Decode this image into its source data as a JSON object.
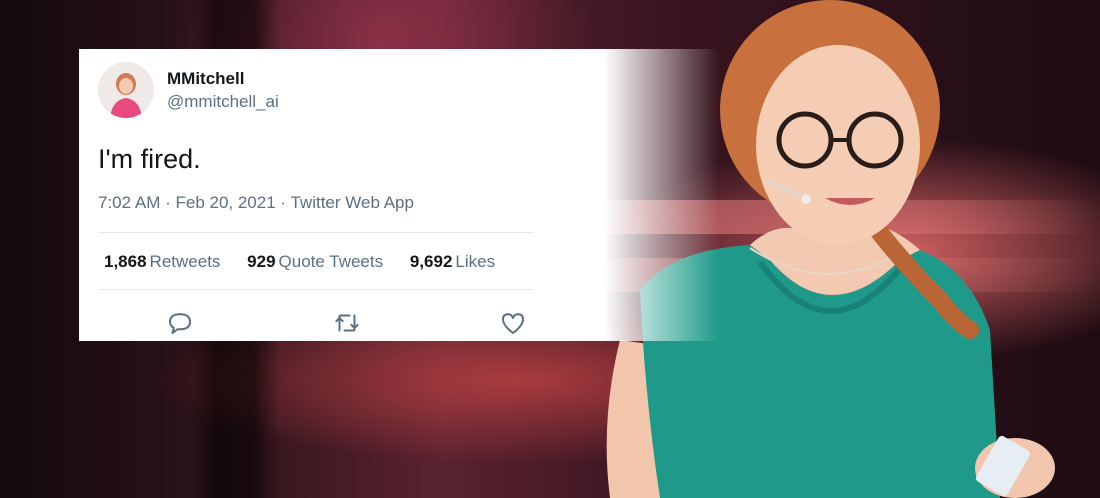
{
  "tweet": {
    "display_name": "MMitchell",
    "handle": "@mmitchell_ai",
    "text": "I'm fired.",
    "meta": "7:02 AM · Feb 20, 2021 · Twitter Web App",
    "stats": {
      "retweets_count": "1,868",
      "retweets_label": "Retweets",
      "quotes_count": "929",
      "quotes_label": "Quote Tweets",
      "likes_count": "9,692",
      "likes_label": "Likes"
    },
    "icons": [
      "reply-icon",
      "retweet-icon",
      "like-icon"
    ]
  },
  "colors": {
    "text_primary": "#14171a",
    "text_secondary": "#5b7083",
    "dress": "#1f9a8a",
    "hair": "#c8703e"
  }
}
